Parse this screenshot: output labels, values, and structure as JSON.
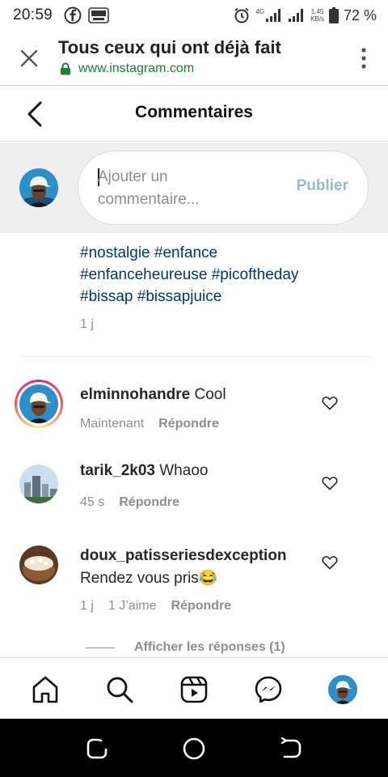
{
  "status_bar": {
    "time": "20:59",
    "network_tag": "4G",
    "speed_value": "1.45",
    "speed_unit": "KB/s",
    "battery": "72 %",
    "left_icons": [
      "facebook-icon",
      "brawl-stars-icon"
    ],
    "right_icons": [
      "alarm-icon",
      "signal-icon",
      "signal-icon",
      "battery-icon"
    ]
  },
  "browser": {
    "title": "Tous ceux qui ont déjà fait",
    "url": "www.instagram.com",
    "url_color": "#1a7f37"
  },
  "header": {
    "title": "Commentaires"
  },
  "composer": {
    "placeholder": "Ajouter un commentaire...",
    "publish_label": "Publier",
    "publish_color": "#9ab7d1"
  },
  "caption": {
    "hashtags": [
      "#nostalgie #enfance",
      "#enfanceheureuse #picoftheday",
      "#bissap #bissapjuice"
    ],
    "time": "1 j"
  },
  "comments": [
    {
      "username": "elminnohandre",
      "text": "Cool",
      "time": "Maintenant",
      "likes": "",
      "reply_label": "Répondre",
      "has_story_ring": true
    },
    {
      "username": "tarik_2k03",
      "text": "Whaoo",
      "time": "45 s",
      "likes": "",
      "reply_label": "Répondre",
      "has_story_ring": false
    },
    {
      "username": "doux_patisseriesdexception",
      "text": "Rendez vous pris😂",
      "time": "1 j",
      "likes": "1 J’aime",
      "reply_label": "Répondre",
      "has_story_ring": false
    }
  ],
  "view_replies": "Afficher les réponses (1)",
  "tab_bar": {
    "items": [
      "home-icon",
      "search-icon",
      "reels-icon",
      "messenger-icon",
      "profile-avatar"
    ]
  },
  "colors": {
    "link": "#00376b",
    "secondary_text": "#8e8e8e"
  }
}
